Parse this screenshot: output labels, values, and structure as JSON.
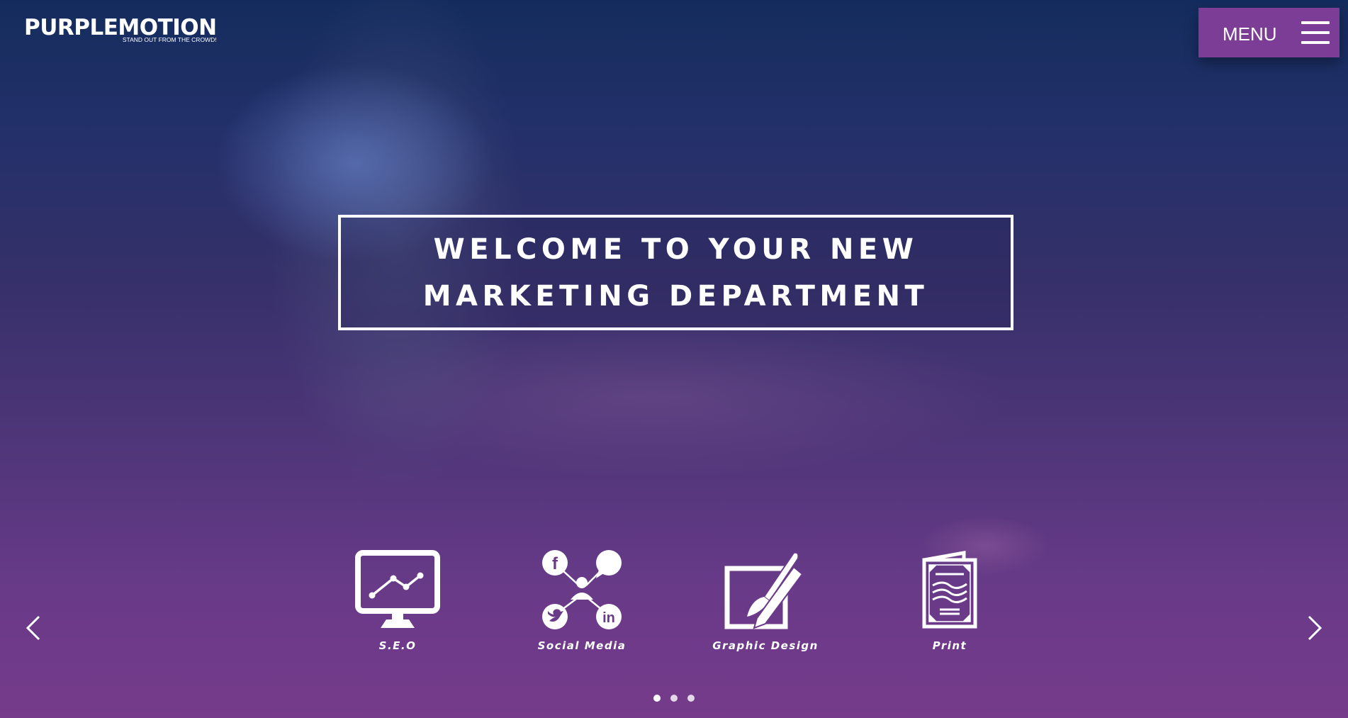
{
  "brand": {
    "name": "PURPLEMOTION",
    "tagline": "STAND OUT FROM THE CROWD!"
  },
  "menu": {
    "label": "MENU",
    "icon": "hamburger-icon",
    "background": "#7b3d96"
  },
  "hero": {
    "line1": "WELCOME TO YOUR NEW",
    "line2": "MARKETING DEPARTMENT"
  },
  "services": [
    {
      "label": "S.E.O",
      "icon": "seo-monitor-icon"
    },
    {
      "label": "Social Media",
      "icon": "social-media-network-icon"
    },
    {
      "label": "Graphic Design",
      "icon": "graphic-design-icon"
    },
    {
      "label": "Print",
      "icon": "print-brochure-icon"
    }
  ],
  "carousel": {
    "prev_icon": "chevron-left-icon",
    "next_icon": "chevron-right-icon",
    "page_count": 3,
    "active_page": 1
  },
  "colors": {
    "background_top": "#142c5d",
    "background_bottom": "#763b8b",
    "text": "#ffffff"
  }
}
